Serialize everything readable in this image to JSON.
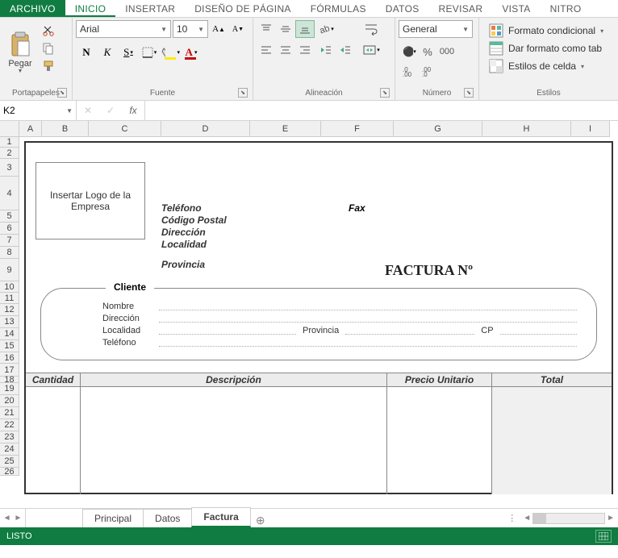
{
  "menu": {
    "file": "ARCHIVO",
    "tabs": [
      "INICIO",
      "INSERTAR",
      "DISEÑO DE PÁGINA",
      "FÓRMULAS",
      "DATOS",
      "REVISAR",
      "VISTA",
      "NITRO"
    ],
    "active": "INICIO"
  },
  "ribbon": {
    "clipboard": {
      "paste": "Pegar",
      "label": "Portapapeles"
    },
    "font": {
      "name": "Arial",
      "size": "10",
      "bold": "N",
      "italic": "K",
      "underline": "S",
      "label": "Fuente",
      "increase": "A",
      "decrease": "A"
    },
    "alignment": {
      "label": "Alineación"
    },
    "number": {
      "format": "General",
      "label": "Número",
      "percent": "%"
    },
    "styles": {
      "cond": "Formato condicional",
      "table": "Dar formato como tab",
      "cell": "Estilos de celda",
      "label": "Estilos"
    }
  },
  "formula": {
    "cell": "K2",
    "fx": "fx"
  },
  "columns": [
    {
      "l": "A",
      "w": 28
    },
    {
      "l": "B",
      "w": 58
    },
    {
      "l": "C",
      "w": 90
    },
    {
      "l": "D",
      "w": 110
    },
    {
      "l": "E",
      "w": 88
    },
    {
      "l": "F",
      "w": 90
    },
    {
      "l": "G",
      "w": 110
    },
    {
      "l": "H",
      "w": 110
    },
    {
      "l": "I",
      "w": 48
    }
  ],
  "rows": [
    {
      "n": 1,
      "h": 13
    },
    {
      "n": 2,
      "h": 14
    },
    {
      "n": 3,
      "h": 22
    },
    {
      "n": 4,
      "h": 42
    },
    {
      "n": 5,
      "h": 15
    },
    {
      "n": 6,
      "h": 15
    },
    {
      "n": 7,
      "h": 15
    },
    {
      "n": 8,
      "h": 15
    },
    {
      "n": 9,
      "h": 28
    },
    {
      "n": 10,
      "h": 14
    },
    {
      "n": 11,
      "h": 14
    },
    {
      "n": 12,
      "h": 15
    },
    {
      "n": 13,
      "h": 15
    },
    {
      "n": 14,
      "h": 15
    },
    {
      "n": 15,
      "h": 15
    },
    {
      "n": 16,
      "h": 14
    },
    {
      "n": 17,
      "h": 16
    },
    {
      "n": 18,
      "h": 8
    },
    {
      "n": 19,
      "h": 15
    },
    {
      "n": 20,
      "h": 15
    },
    {
      "n": 21,
      "h": 15
    },
    {
      "n": 22,
      "h": 15
    },
    {
      "n": 23,
      "h": 15
    },
    {
      "n": 24,
      "h": 15
    },
    {
      "n": 25,
      "h": 15
    },
    {
      "n": 26,
      "h": 10
    }
  ],
  "invoice": {
    "logo": "Insertar Logo de la Empresa",
    "tel": "Teléfono",
    "fax": "Fax",
    "cp": "Código Postal",
    "dir": "Dirección",
    "loc": "Localidad",
    "prov": "Provincia",
    "title": "FACTURA Nº",
    "cliente": {
      "title": "Cliente",
      "nombre": "Nombre",
      "direccion": "Dirección",
      "localidad": "Localidad",
      "provincia": "Provincia",
      "cp": "CP",
      "telefono": "Teléfono"
    },
    "cols": {
      "qty": "Cantidad",
      "desc": "Descripción",
      "price": "Precio Unitario",
      "total": "Total"
    }
  },
  "sheets": {
    "nav": "‹ ›",
    "tabs": [
      "Principal",
      "Datos",
      "Factura"
    ],
    "active": "Factura",
    "add": "⊕",
    "dots": "⋮"
  },
  "status": {
    "ready": "LISTO"
  }
}
